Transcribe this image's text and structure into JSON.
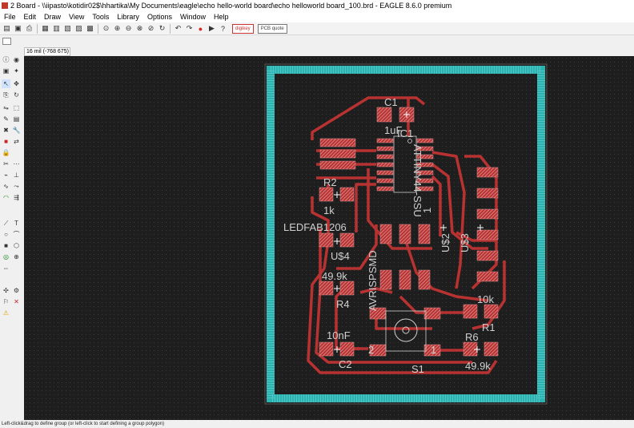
{
  "window": {
    "title": "2 Board - \\\\iipasto\\kotidir02$\\hhartika\\My Documents\\eagle\\echo hello-world board\\echo helloworld board_100.brd - EAGLE 8.6.0 premium"
  },
  "menu": [
    "File",
    "Edit",
    "Draw",
    "View",
    "Tools",
    "Library",
    "Options",
    "Window",
    "Help"
  ],
  "toolbar": {
    "icons": [
      "open-icon",
      "save-icon",
      "print-icon",
      "cam-icon",
      "board-icon",
      "library-icon",
      "script-icon",
      "ulp-icon",
      "zoom-fit-icon",
      "zoom-in-icon",
      "zoom-out-icon",
      "zoom-area-icon",
      "zoom-select-icon",
      "redraw-icon",
      "undo-icon",
      "redo-icon",
      "stop-icon",
      "go-icon",
      "help-icon"
    ],
    "badge_digikey": "digikey",
    "badge_pcb": "PCB quote"
  },
  "coord": {
    "text": "16 mil (-768 675)"
  },
  "status": {
    "text": "Left-click&drag to define group (or left-click to start defining a group polygon)"
  },
  "board": {
    "labels": {
      "c1": "C1",
      "c1_value": "1uF",
      "ic1": "IC1",
      "ic1_value": "ATTINY44-SSU",
      "pin1": "1",
      "r2": "R2",
      "r2_value": "1k",
      "led": "LEDFAB1206",
      "u4": "U$4",
      "avr": "AVRISPSMD",
      "u2": "U$2",
      "u3": "U$3",
      "r4_value": "49.9k",
      "r4": "R4",
      "r1_value": "10k",
      "r1": "R1",
      "c2_value": "10nF",
      "c2": "C2",
      "r6": "R6",
      "r6_value": "49.9k",
      "s1": "S1",
      "s1_p2": "2",
      "s1_p1": "1"
    },
    "colors": {
      "background": "#1e1e1e",
      "outline": "#2bb3b1",
      "trace": "#b83232",
      "pad": "#d98c8c",
      "text": "#cfcfcf"
    }
  }
}
